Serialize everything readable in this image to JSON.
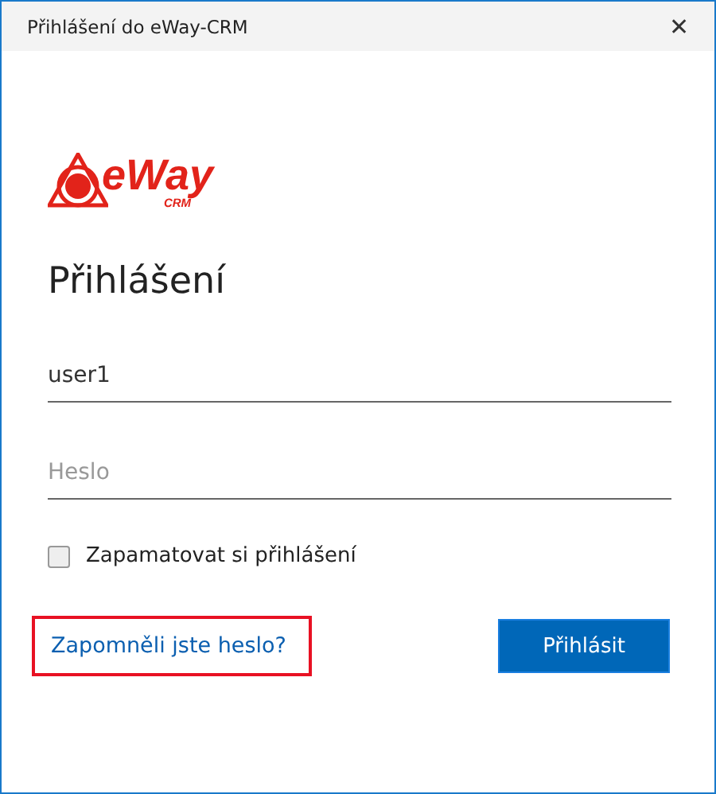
{
  "window": {
    "title": "Přihlášení do eWay-CRM",
    "close": "✕"
  },
  "logo": {
    "name": "eWay",
    "sub": "CRM"
  },
  "heading": "Přihlášení",
  "fields": [
    {
      "value": "user1"
    },
    {
      "placeholder": "Heslo"
    }
  ],
  "remember": {
    "label": "Zapamatovat si přihlášení",
    "checked": false
  },
  "forgot_link": {
    "label": "Zapomněli jste heslo?",
    "highlighted": true
  },
  "login_button": "Přihlásit"
}
